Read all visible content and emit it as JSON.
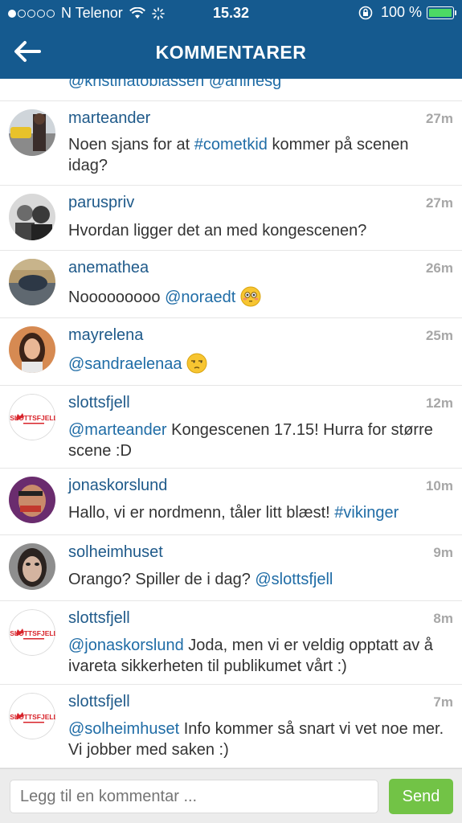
{
  "status_bar": {
    "carrier": "N Telenor",
    "time": "15.32",
    "battery": "100 %"
  },
  "header": {
    "title": "KOMMENTARER",
    "back_icon": "arrow-left-icon"
  },
  "partial_comment": {
    "text": "@kristinatobiassen @aninesg"
  },
  "comments": [
    {
      "username": "marteander",
      "time": "27m",
      "parts": [
        {
          "t": "Noen sjans for at "
        },
        {
          "t": "#cometkid",
          "cls": "tag"
        },
        {
          "t": " kommer på scenen idag?"
        }
      ]
    },
    {
      "username": "paruspriv",
      "time": "27m",
      "parts": [
        {
          "t": "Hvordan ligger det an med kongescenen?"
        }
      ]
    },
    {
      "username": "anemathea",
      "time": "26m",
      "parts": [
        {
          "t": "Nooooooooo "
        },
        {
          "t": "@noraedt",
          "cls": "mention"
        },
        {
          "t": " "
        },
        {
          "emoji": "flushed-face-emoji"
        }
      ]
    },
    {
      "username": "mayrelena",
      "time": "25m",
      "parts": [
        {
          "t": "@sandraelenaa",
          "cls": "mention"
        },
        {
          "t": " "
        },
        {
          "emoji": "unamused-face-emoji"
        }
      ]
    },
    {
      "username": "slottsfjell",
      "time": "12m",
      "parts": [
        {
          "t": "@marteander",
          "cls": "mention"
        },
        {
          "t": " Kongescenen 17.15! Hurra for større scene :D"
        }
      ]
    },
    {
      "username": "jonaskorslund",
      "time": "10m",
      "parts": [
        {
          "t": "Hallo, vi er nordmenn, tåler litt blæst! "
        },
        {
          "t": "#vikinger",
          "cls": "tag"
        }
      ]
    },
    {
      "username": "solheimhuset",
      "time": "9m",
      "parts": [
        {
          "t": "Orango? Spiller de i dag? "
        },
        {
          "t": "@slottsfjell",
          "cls": "mention"
        }
      ]
    },
    {
      "username": "slottsfjell",
      "time": "8m",
      "parts": [
        {
          "t": "@jonaskorslund",
          "cls": "mention"
        },
        {
          "t": " Joda, men vi er veldig opptatt av å ivareta sikkerheten til publikumet vårt :)"
        }
      ]
    },
    {
      "username": "slottsfjell",
      "time": "7m",
      "parts": [
        {
          "t": "@solheimhuset",
          "cls": "mention"
        },
        {
          "t": " Info kommer så snart vi vet noe mer. Vi jobber med saken :)"
        }
      ]
    }
  ],
  "slottsfjell_logo_text": "SLOTTSFJELL",
  "comment_input": {
    "placeholder": "Legg til en kommentar ..."
  },
  "send_button": {
    "label": "Send"
  },
  "colors": {
    "header": "#155a8f",
    "link": "#1f6ca6",
    "send": "#72c346",
    "battery": "#4cd964"
  }
}
